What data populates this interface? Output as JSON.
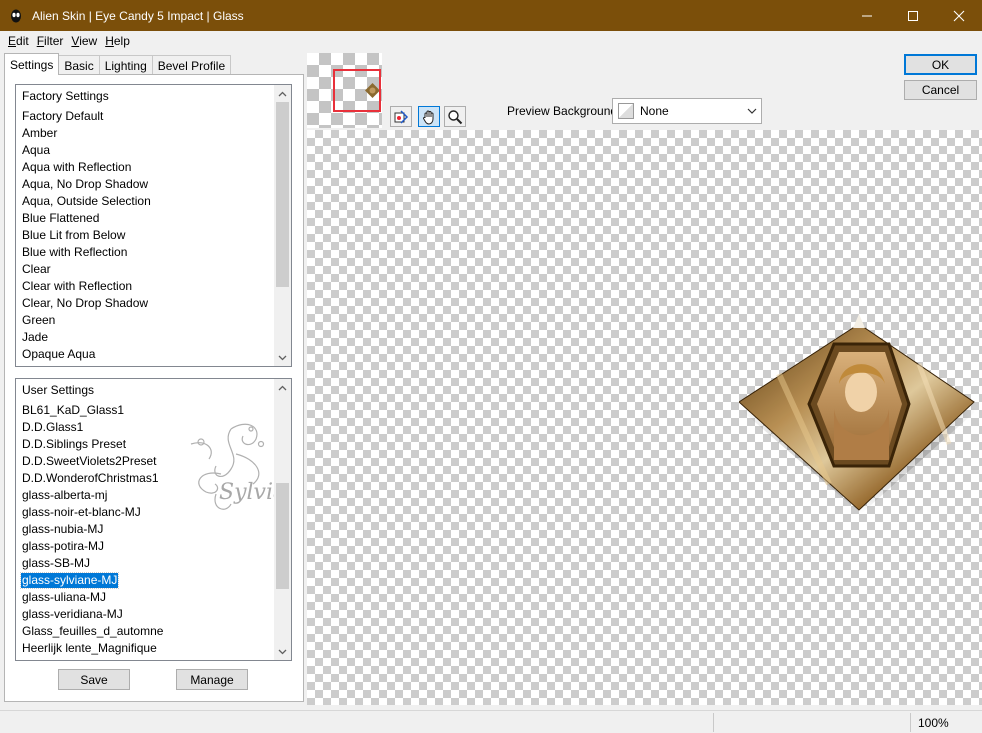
{
  "window": {
    "title": "Alien Skin | Eye Candy 5 Impact | Glass",
    "title_bar_color": "#7b4f0a"
  },
  "menu": [
    {
      "label": "Edit",
      "accel": "E",
      "rest": "dit"
    },
    {
      "label": "Filter",
      "accel": "F",
      "rest": "ilter"
    },
    {
      "label": "View",
      "accel": "V",
      "rest": "iew"
    },
    {
      "label": "Help",
      "accel": "H",
      "rest": "elp"
    }
  ],
  "tabs": [
    "Settings",
    "Basic",
    "Lighting",
    "Bevel Profile"
  ],
  "factory_settings": {
    "header": "Factory Settings",
    "items": [
      "Factory Default",
      "Amber",
      "Aqua",
      "Aqua with Reflection",
      "Aqua, No Drop Shadow",
      "Aqua, Outside Selection",
      "Blue Flattened",
      "Blue Lit from Below",
      "Blue with Reflection",
      "Clear",
      "Clear with Reflection",
      "Clear, No Drop Shadow",
      "Green",
      "Jade",
      "Opaque Aqua"
    ]
  },
  "user_settings": {
    "header": "User Settings",
    "items": [
      "BL61_KaD_Glass1",
      "D.D.Glass1",
      "D.D.Siblings Preset",
      "D.D.SweetViolets2Preset",
      "D.D.WonderofChristmas1",
      "glass-alberta-mj",
      "glass-noir-et-blanc-MJ",
      "glass-nubia-MJ",
      "glass-potira-MJ",
      "glass-SB-MJ",
      "glass-sylviane-MJ",
      "glass-uliana-MJ",
      "glass-veridiana-MJ",
      "Glass_feuilles_d_automne",
      "Heerlijk lente_Magnifique"
    ],
    "selected": "glass-sylviane-MJ"
  },
  "watermark_text": "Sylviane",
  "buttons": {
    "save": "Save",
    "manage": "Manage",
    "ok": "OK",
    "cancel": "Cancel"
  },
  "preview_background": {
    "label": "Preview Background:",
    "value": "None"
  },
  "tools": [
    "navigate-render-icon",
    "hand-icon",
    "zoom-icon"
  ],
  "status": {
    "zoom": "100%"
  },
  "colors": {
    "selection": "#0078d7",
    "navigator_frame": "#e8303a"
  }
}
